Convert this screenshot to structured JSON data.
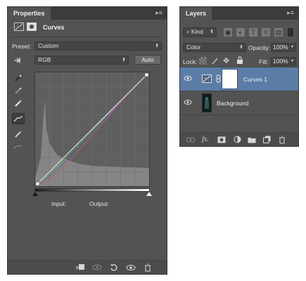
{
  "properties": {
    "tab_title": "Properties",
    "header_title": "Curves",
    "preset_label": "Preset:",
    "preset_value": "Custom",
    "channel_value": "RGB",
    "auto_button": "Auto",
    "input_label": "Input:",
    "output_label": "Output:",
    "tools": [
      "sample-in-image-icon",
      "black-point-eyedropper-icon",
      "gray-point-eyedropper-icon",
      "white-point-eyedropper-icon",
      "edit-curve-points-icon",
      "draw-curve-pencil-icon",
      "smooth-curve-icon"
    ],
    "bottom_icons": [
      "clip-to-layer-icon",
      "view-previous-state-icon",
      "reset-defaults-icon",
      "toggle-visibility-icon",
      "delete-adjustment-icon"
    ]
  },
  "layers": {
    "tab_title": "Layers",
    "filter_kind": "Kind",
    "blend_mode": "Color",
    "opacity_label": "Opacity:",
    "opacity_value": "100%",
    "lock_label": "Lock:",
    "fill_label": "Fill:",
    "fill_value": "100%",
    "items": [
      {
        "name": "Curves 1",
        "selected": true,
        "visible": true
      },
      {
        "name": "Background",
        "selected": false,
        "visible": true
      }
    ],
    "bottom_icons": [
      "link-layers-icon",
      "layer-style-fx-icon",
      "add-mask-icon",
      "new-adjustment-layer-icon",
      "new-group-folder-icon",
      "new-layer-icon",
      "trash-icon"
    ]
  },
  "colors": {
    "panel_bg": "#535353",
    "selected_row": "#5b7da7",
    "curve_line": "#dcdcdc",
    "red_channel": "#c85a6a",
    "green_channel": "#5aa05a",
    "blue_channel": "#5a6ac8"
  }
}
